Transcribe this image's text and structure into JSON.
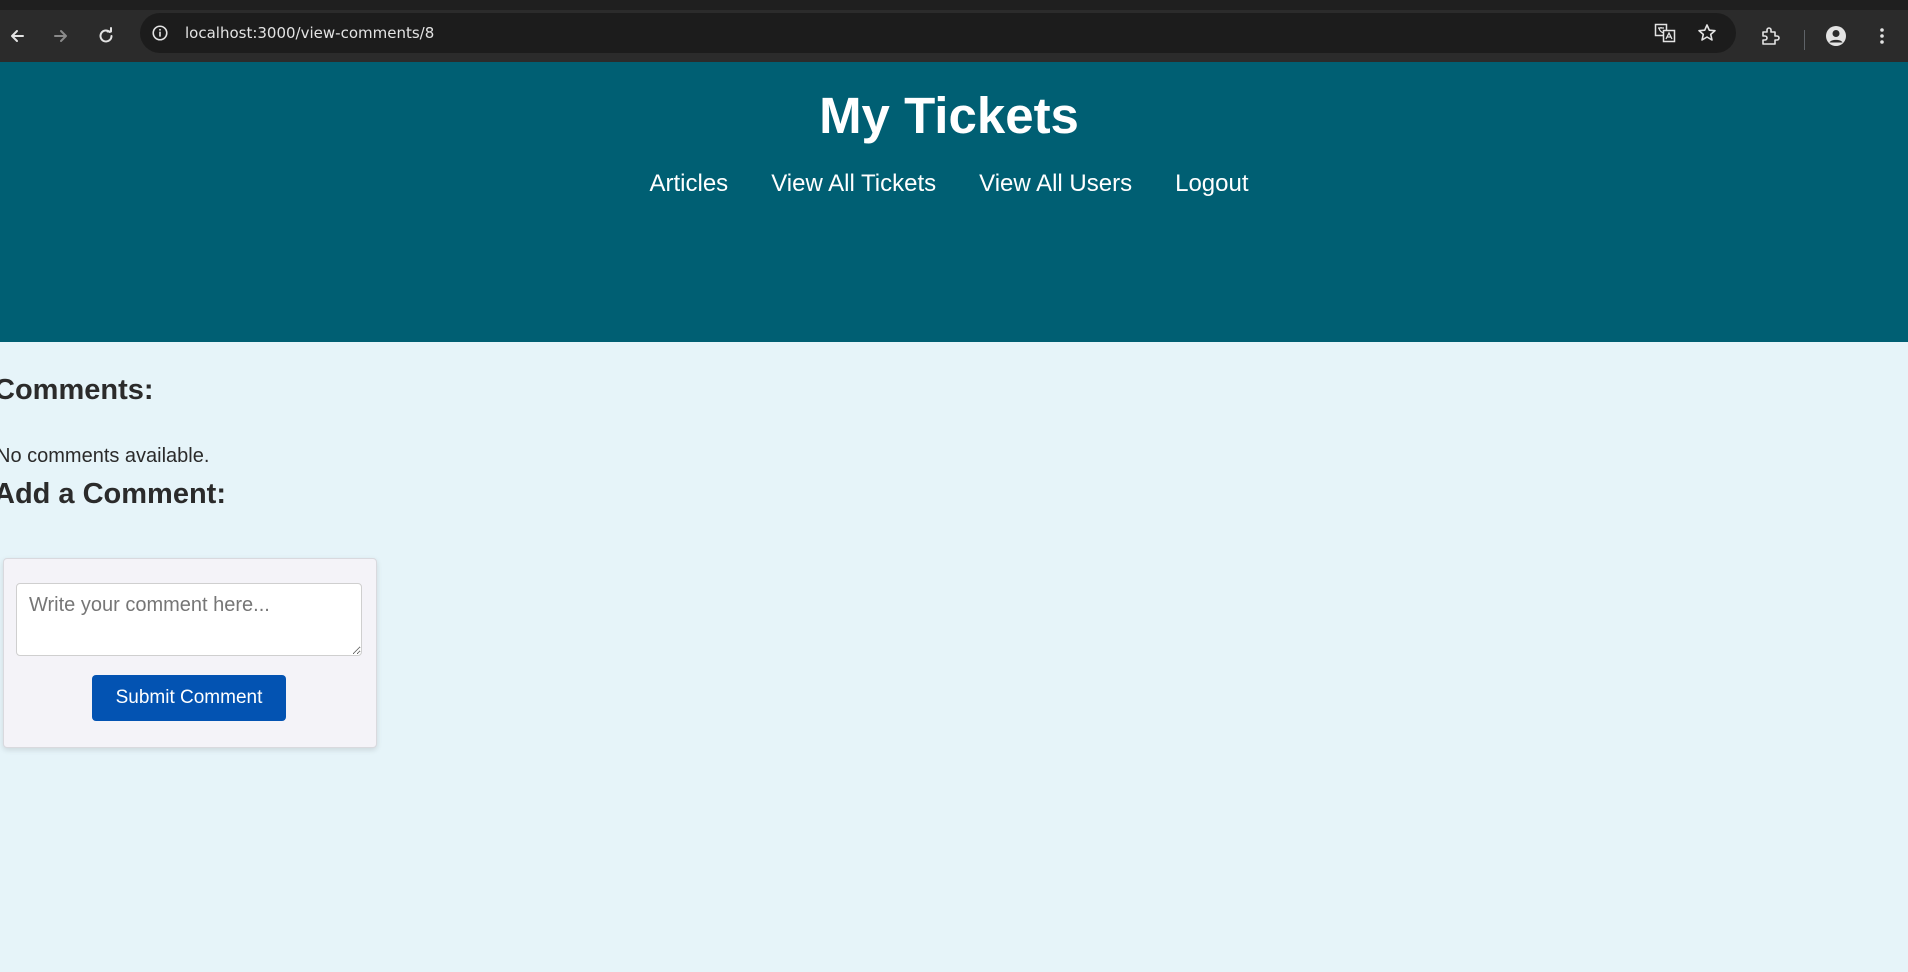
{
  "browser": {
    "url": "localhost:3000/view-comments/8",
    "icons": [
      "back-arrow-icon",
      "forward-arrow-icon",
      "reload-icon",
      "site-info-icon",
      "translate-icon",
      "bookmark-star-icon",
      "extensions-icon",
      "profile-icon",
      "more-menu-icon"
    ]
  },
  "header": {
    "title": "My Tickets",
    "nav": {
      "articles": "Articles",
      "view_all_tickets": "View All Tickets",
      "view_all_users": "View All Users",
      "logout": "Logout"
    }
  },
  "comments": {
    "heading": "Comments:",
    "empty_message": "No comments available."
  },
  "add_comment": {
    "heading": "Add a Comment:",
    "textarea_placeholder": "Write your comment here...",
    "submit_label": "Submit Comment"
  },
  "colors": {
    "header_bg": "#005f73",
    "page_bg": "#e6f4f9",
    "button_bg": "#0353b2",
    "text_dark": "#2b2b2b"
  }
}
